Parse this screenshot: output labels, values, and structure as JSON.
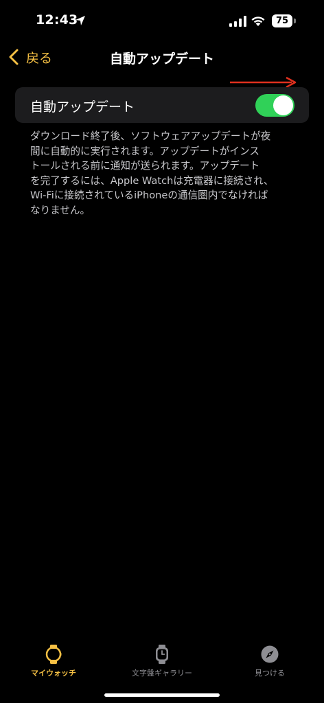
{
  "status_bar": {
    "time": "12:43",
    "battery_level": "75"
  },
  "nav": {
    "back_label": "戻る",
    "title": "自動アップデート"
  },
  "setting": {
    "label": "自動アップデート",
    "enabled": true
  },
  "description": {
    "lines": [
      "ダウンロード終了後、ソフトウェアアップデートが夜",
      "間に自動的に実行されます。アップデートがインス",
      "トールされる前に通知が送られます。アップデート",
      "を完了するには、Apple Watchは充電器に接続され、",
      "Wi-Fiに接続されているiPhoneの通信圏内でなければ",
      "なりません。"
    ]
  },
  "tab_bar": {
    "tabs": [
      {
        "label": "マイウォッチ",
        "icon": "watch-icon",
        "active": true
      },
      {
        "label": "文字盤ギャラリー",
        "icon": "watch-face-icon",
        "active": false
      },
      {
        "label": "見つける",
        "icon": "compass-icon",
        "active": false
      }
    ]
  },
  "colors": {
    "accent": "#f5c044",
    "toggle_on": "#30d158",
    "cell_background": "#1c1c1e",
    "annotation_arrow": "#e0301e"
  }
}
